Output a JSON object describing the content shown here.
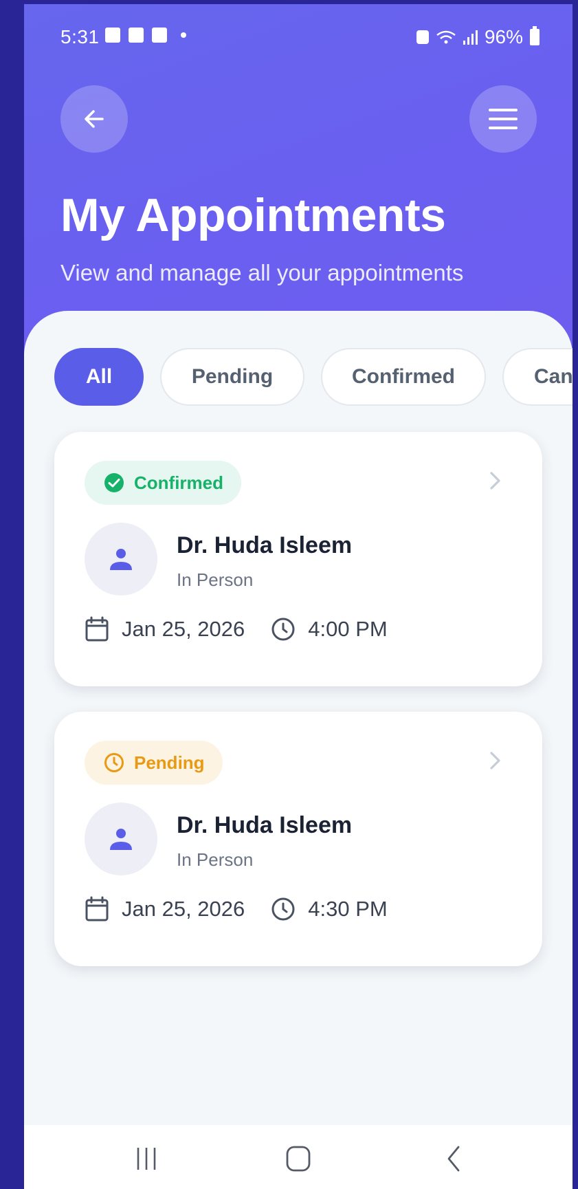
{
  "status_bar": {
    "time": "5:31",
    "battery": "96%"
  },
  "header": {
    "title": "My Appointments",
    "subtitle": "View and manage all your appointments",
    "back_icon": "arrow-left-icon",
    "menu_icon": "hamburger-menu-icon"
  },
  "filters": [
    {
      "label": "All",
      "active": true
    },
    {
      "label": "Pending",
      "active": false
    },
    {
      "label": "Confirmed",
      "active": false
    },
    {
      "label": "Canc",
      "active": false
    }
  ],
  "appointments": [
    {
      "status": "Confirmed",
      "status_icon": "check-circle-icon",
      "status_color": "#16b26a",
      "doctor": "Dr. Huda Isleem",
      "type": "In Person",
      "date": "Jan 25, 2026",
      "time": "4:00 PM"
    },
    {
      "status": "Pending",
      "status_icon": "clock-icon",
      "status_color": "#e99a14",
      "doctor": "Dr. Huda Isleem",
      "type": "In Person",
      "date": "Jan 25, 2026",
      "time": "4:30 PM"
    }
  ],
  "colors": {
    "accent": "#5a5de8",
    "header_gradient_start": "#6666ee",
    "header_gradient_end": "#6e5ef0"
  }
}
